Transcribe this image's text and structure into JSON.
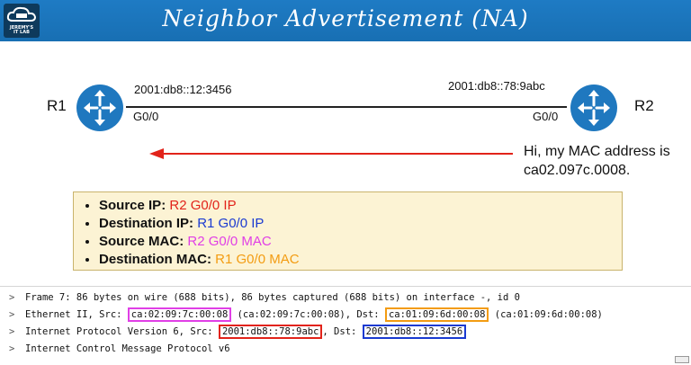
{
  "header": {
    "logo_text_1": "JEREMY'S",
    "logo_text_2": "IT LAB",
    "title": "Neighbor Advertisement (NA)",
    "colors": {
      "header_bg": "#1e7bc4"
    }
  },
  "diagram": {
    "r1": {
      "name": "R1",
      "ipv6": "2001:db8::12:3456",
      "interface": "G0/0",
      "icon": "router-icon"
    },
    "r2": {
      "name": "R2",
      "ipv6": "2001:db8::78:9abc",
      "interface": "G0/0",
      "icon": "router-icon"
    },
    "speech_line1": "Hi, my MAC address is",
    "speech_line2": "ca02.097c.0008."
  },
  "info": {
    "items": [
      {
        "label": "Source IP",
        "sep": ": ",
        "value": "R2 G0/0 IP",
        "color": "#e2231a"
      },
      {
        "label": "Destination IP",
        "sep": ": ",
        "value": "R1 G0/0 IP",
        "color": "#1a3ad1"
      },
      {
        "label": "Source MAC",
        "sep": ": ",
        "value": "R2 G0/0 MAC",
        "color": "#e03fe6"
      },
      {
        "label": "Destination MAC",
        "sep": ": ",
        "value": "R1 G0/0 MAC",
        "color": "#f39c12"
      }
    ]
  },
  "packet": {
    "frame": "Frame 7: 86 bytes on wire (688 bits), 86 bytes captured (688 bits) on interface -, id 0",
    "eth_prefix": "Ethernet II, Src: ",
    "eth_src": "ca:02:09:7c:00:08",
    "eth_mid": " (ca:02:09:7c:00:08), Dst: ",
    "eth_dst": "ca:01:09:6d:00:08",
    "eth_suffix": " (ca:01:09:6d:00:08)",
    "ip_prefix": "Internet Protocol Version 6, Src: ",
    "ip_src": "2001:db8::78:9abc",
    "ip_mid": ", Dst: ",
    "ip_dst": "2001:db8::12:3456",
    "icmp": "Internet Control Message Protocol v6",
    "chevron": ">"
  }
}
